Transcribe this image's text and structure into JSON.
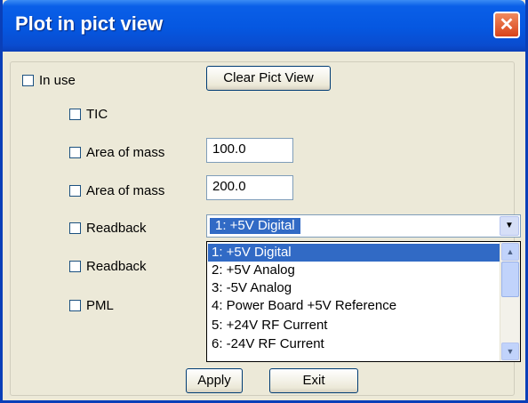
{
  "window": {
    "title": "Plot in pict view",
    "close_glyph": "✕"
  },
  "in_use": {
    "label": "In use"
  },
  "clear_button": {
    "label": "Clear Pict View"
  },
  "rows": [
    {
      "label": "TIC"
    },
    {
      "label": "Area of mass",
      "value": "100.0"
    },
    {
      "label": "Area of mass",
      "value": "200.0"
    },
    {
      "label": "Readback"
    },
    {
      "label": "Readback"
    },
    {
      "label": "PML"
    }
  ],
  "readback_combo": {
    "selected": "1:  +5V Digital",
    "arrow_glyph": "▼"
  },
  "dropdown": {
    "items": [
      "1:  +5V Digital",
      "2:  +5V Analog",
      "3:  -5V Analog",
      "4:  Power Board +5V Reference",
      "5:  +24V RF Current",
      "6:  -24V RF Current"
    ],
    "selected_index": 0,
    "scroll_up_glyph": "▲",
    "scroll_down_glyph": "▼"
  },
  "footer": {
    "apply_label": "Apply",
    "exit_label": "Exit"
  },
  "colors": {
    "titlebar": "#0557e0",
    "selection": "#316ac5",
    "dialog_bg": "#ece9d8",
    "close_button": "#d8431a"
  }
}
